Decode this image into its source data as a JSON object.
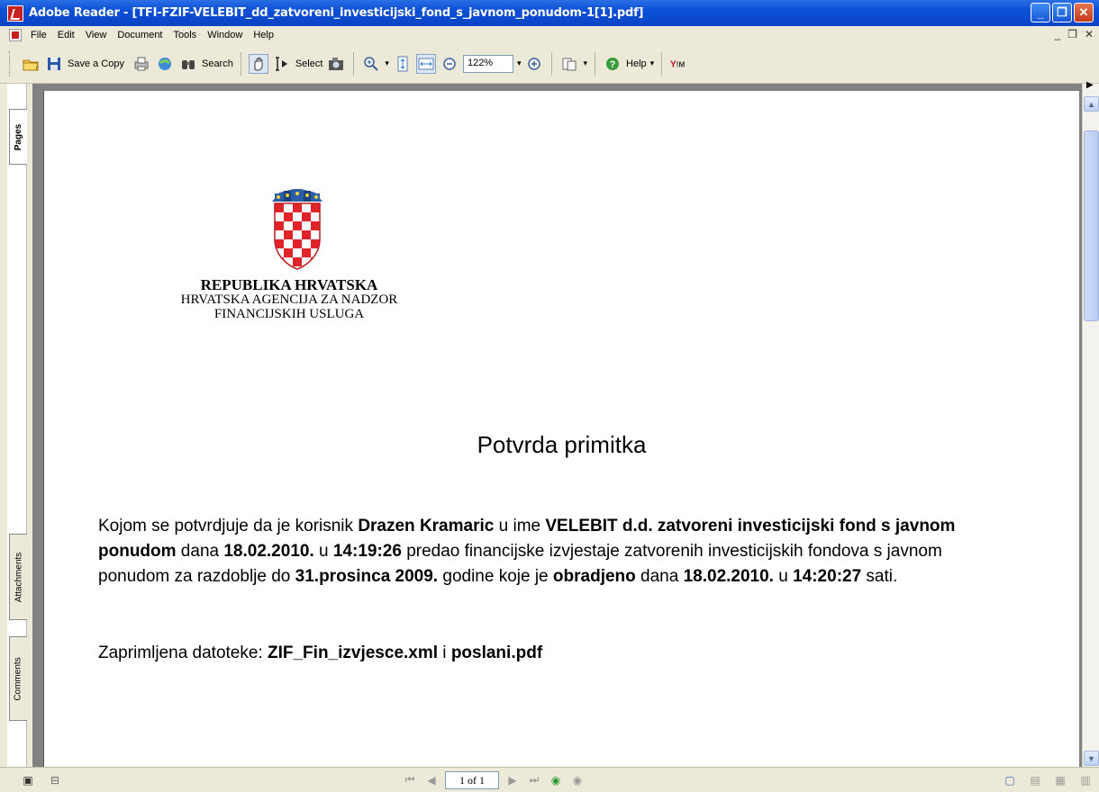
{
  "window": {
    "title": "Adobe Reader - [TFI-FZIF-VELEBIT_dd_zatvoreni_investicijski_fond_s_javnom_ponudom-1[1].pdf]"
  },
  "menu": {
    "items": [
      "File",
      "Edit",
      "View",
      "Document",
      "Tools",
      "Window",
      "Help"
    ]
  },
  "toolbar": {
    "save_copy": "Save a Copy",
    "search": "Search",
    "select": "Select",
    "zoom": "122%",
    "help": "Help"
  },
  "nav_tabs": {
    "pages": "Pages",
    "attachments": "Attachments",
    "comments": "Comments"
  },
  "document": {
    "header_main": "REPUBLIKA HRVATSKA",
    "header_sub1": "HRVATSKA AGENCIJA ZA NADZOR",
    "header_sub2": "FINANCIJSKIH USLUGA",
    "title": "Potvrda primitka",
    "p1_a": "Kojom se potvrdjuje da je korisnik ",
    "p1_user": "Drazen Kramaric",
    "p1_b": " u ime ",
    "p1_company": "VELEBIT d.d. zatvoreni investicijski fond s javnom ponudom",
    "p1_c": " dana ",
    "p1_date1": "18.02.2010.",
    "p1_d": " u ",
    "p1_time1": "14:19:26",
    "p1_e": " predao financijske izvjestaje zatvorenih investicijskih fondova s javnom ponudom za razdoblje do ",
    "p1_period": "31.prosinca 2009.",
    "p1_f": " godine koje je ",
    "p1_processed": "obradjeno",
    "p1_g": " dana ",
    "p1_date2": "18.02.2010.",
    "p1_h": " u ",
    "p1_time2": "14:20:27",
    "p1_i": " sati.",
    "files_label": "Zaprimljena datoteke: ",
    "file1": "ZIF_Fin_izvjesce.xml",
    "files_and": " i ",
    "file2": "poslani.pdf"
  },
  "status": {
    "page_indicator": "1 of 1"
  },
  "colors": {
    "titlebar": "#0a4fd6",
    "chrome": "#ece9d8",
    "doc_background": "#828282",
    "coa_red": "#e0242a"
  }
}
